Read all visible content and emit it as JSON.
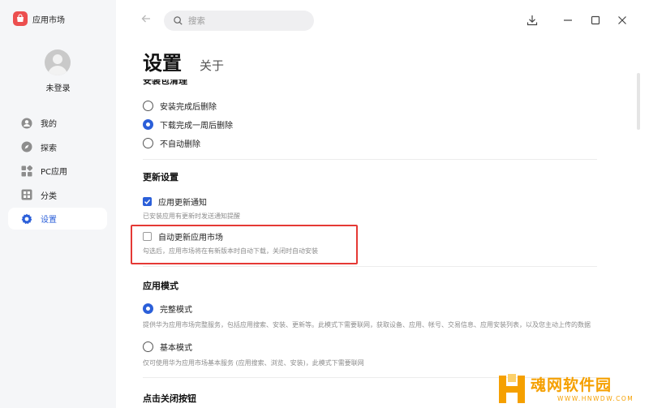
{
  "app": {
    "title": "应用市场",
    "brand_color": "#ec4f4f",
    "accent_color": "#2b5fd9"
  },
  "sidebar": {
    "username": "未登录",
    "items": [
      {
        "label": "我的",
        "icon": "person-icon",
        "active": false
      },
      {
        "label": "探索",
        "icon": "compass-icon",
        "active": false
      },
      {
        "label": "PC应用",
        "icon": "apps-icon",
        "active": false
      },
      {
        "label": "分类",
        "icon": "grid-icon",
        "active": false
      },
      {
        "label": "设置",
        "icon": "gear-icon",
        "active": true
      }
    ]
  },
  "topbar": {
    "search_placeholder": "搜索",
    "buttons": [
      "download-icon",
      "minimize-icon",
      "maximize-icon",
      "close-icon"
    ]
  },
  "page": {
    "tabs": [
      {
        "label": "设置",
        "active": true
      },
      {
        "label": "关于",
        "active": false
      }
    ]
  },
  "settings": {
    "package_cleanup": {
      "title": "安装包清理",
      "options": [
        {
          "label": "安装完成后删除",
          "checked": false
        },
        {
          "label": "下载完成一周后删除",
          "checked": true
        },
        {
          "label": "不自动删除",
          "checked": false
        }
      ]
    },
    "update": {
      "title": "更新设置",
      "notify": {
        "label": "应用更新通知",
        "checked": true,
        "desc": "已安装应用有更新时发送通知提醒"
      },
      "auto_update": {
        "label": "自动更新应用市场",
        "checked": false,
        "desc": "勾选后，应用市场将在有新版本时自动下载，关闭时自动安装"
      }
    },
    "app_mode": {
      "title": "应用模式",
      "full": {
        "label": "完整模式",
        "checked": true,
        "desc": "提供华为应用市场完整服务，包括应用搜索、安装、更新等。此模式下需要联网，获取设备、应用、帐号、交易信息、应用安装列表，以及您主动上传的数据"
      },
      "basic": {
        "label": "基本模式",
        "checked": false,
        "desc": "仅可使用华为应用市场基本服务 (应用搜索、浏览、安装)，此模式下需要联网"
      }
    },
    "close_button": {
      "title": "点击关闭按钮"
    }
  },
  "watermark": {
    "text": "魂网软件园",
    "sub": "WWW.HNWDW.COM",
    "color": "#f5a000"
  }
}
